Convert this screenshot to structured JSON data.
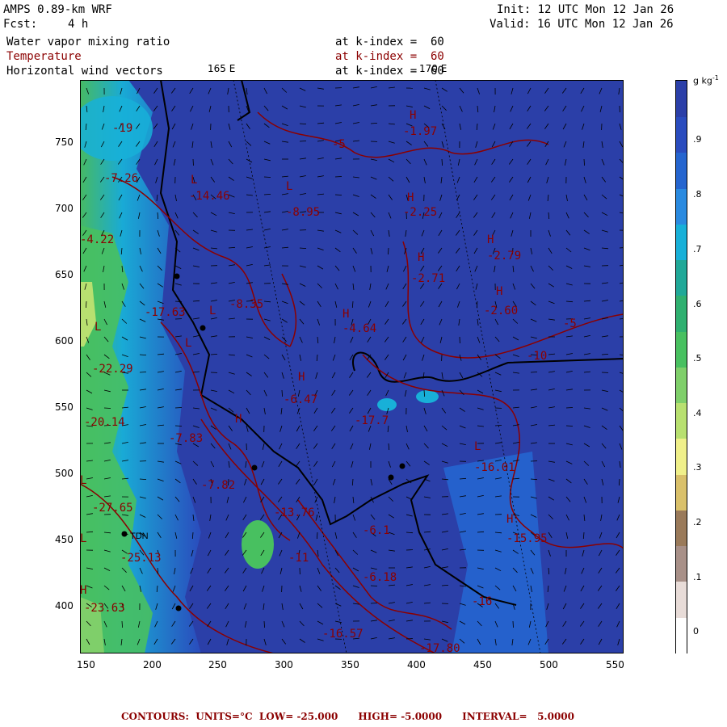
{
  "header": {
    "model": "AMPS 0.89-km WRF",
    "fcst_label": "Fcst:",
    "fcst_value": "4 h",
    "init": "Init: 12 UTC Mon 12 Jan 26",
    "valid": "Valid: 16 UTC Mon 12 Jan 26"
  },
  "fields": [
    {
      "name": "Water vapor mixing ratio",
      "level": "at k-index =  60",
      "color": "#000000"
    },
    {
      "name": "Temperature",
      "level": "at k-index =  60",
      "color": "#8b0000"
    },
    {
      "name": "Horizontal wind vectors",
      "level": "at k-index =  60",
      "color": "#000000"
    }
  ],
  "longitude_labels": [
    "165 E",
    "170 E"
  ],
  "x_ticks": [
    "150",
    "200",
    "250",
    "300",
    "350",
    "400",
    "450",
    "500",
    "550"
  ],
  "y_ticks": [
    "750",
    "700",
    "650",
    "600",
    "550",
    "500",
    "450",
    "400"
  ],
  "colorbar": {
    "unit": "g kg",
    "unit_sup": "-1",
    "labels": [
      ".9",
      ".8",
      ".7",
      ".6",
      ".5",
      ".4",
      ".3",
      ".2",
      ".1",
      "0"
    ],
    "colors": [
      "#ffffff",
      "#e8dcd8",
      "#a89088",
      "#9a7a5a",
      "#d9c06a",
      "#f0f08a",
      "#b8e070",
      "#7fcf6a",
      "#48c060",
      "#2fb070",
      "#20a898",
      "#18b0d8",
      "#2a8ae0",
      "#2565cf",
      "#2a4cbe",
      "#2b3fa8"
    ]
  },
  "contour_labels": [
    {
      "text": "-5"
    },
    {
      "text": "-1.97"
    },
    {
      "text": "-2.25"
    },
    {
      "text": "-2.79"
    },
    {
      "text": "-2.71"
    },
    {
      "text": "-2.60"
    },
    {
      "text": "-5"
    },
    {
      "text": "-10"
    },
    {
      "text": "-14.46"
    },
    {
      "text": "-8.95"
    },
    {
      "text": "-8.35"
    },
    {
      "text": "-4.64"
    },
    {
      "text": "-6.47"
    },
    {
      "text": "-17.7"
    },
    {
      "text": "-16.01"
    },
    {
      "text": "-15.95"
    },
    {
      "text": "-16"
    },
    {
      "text": "-16.57"
    },
    {
      "text": "-17.63"
    },
    {
      "text": "-22.29"
    },
    {
      "text": "-20.14"
    },
    {
      "text": "-7.83"
    },
    {
      "text": "-7.82"
    },
    {
      "text": "-27.65"
    },
    {
      "text": "-25.13"
    },
    {
      "text": "-23.63"
    },
    {
      "text": "-13.76"
    },
    {
      "text": "-6.1"
    },
    {
      "text": "-6.18"
    },
    {
      "text": "-7.26"
    },
    {
      "text": "-4.22"
    },
    {
      "text": "-19"
    },
    {
      "text": "-17.80"
    },
    {
      "text": "-11"
    }
  ],
  "hl_labels": [
    "H",
    "H",
    "H",
    "H",
    "H",
    "H",
    "H",
    "L",
    "L",
    "L",
    "L",
    "L",
    "L",
    "H",
    "H",
    "L",
    "L",
    "H"
  ],
  "place_label": "TDN",
  "footer": "CONTOURS:  UNITS=°C  LOW= -25.000      HIGH= -5.0000      INTERVAL=   5.0000"
}
